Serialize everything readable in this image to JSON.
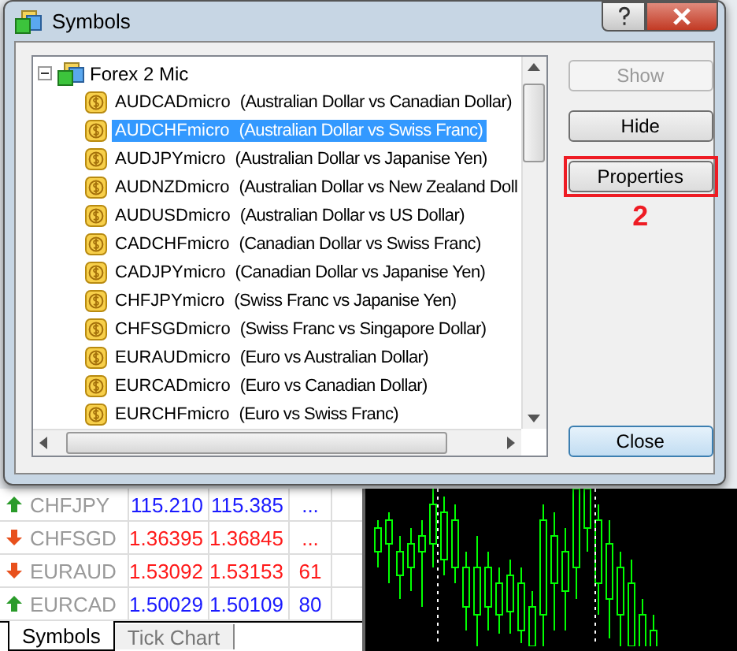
{
  "window": {
    "title": "Symbols"
  },
  "tree": {
    "root": "Forex 2 Mic",
    "expanded": true,
    "items": [
      {
        "code": "AUDCADmicro",
        "description": "(Australian Dollar vs Canadian Dollar)",
        "selected": false
      },
      {
        "code": "AUDCHFmicro",
        "description": "(Australian Dollar vs Swiss Franc)",
        "selected": true
      },
      {
        "code": "AUDJPYmicro",
        "description": "(Australian Dollar vs Japanise Yen)",
        "selected": false
      },
      {
        "code": "AUDNZDmicro",
        "description": "(Australian Dollar vs New Zealand Doll",
        "selected": false
      },
      {
        "code": "AUDUSDmicro",
        "description": "(Australian Dollar vs US Dollar)",
        "selected": false
      },
      {
        "code": "CADCHFmicro",
        "description": "(Canadian Dollar vs Swiss Franc)",
        "selected": false
      },
      {
        "code": "CADJPYmicro",
        "description": "(Canadian Dollar vs Japanise Yen)",
        "selected": false
      },
      {
        "code": "CHFJPYmicro",
        "description": "(Swiss Franc vs Japanise Yen)",
        "selected": false
      },
      {
        "code": "CHFSGDmicro",
        "description": "(Swiss Franc vs Singapore Dollar)",
        "selected": false
      },
      {
        "code": "EURAUDmicro",
        "description": "(Euro vs Australian Dollar)",
        "selected": false
      },
      {
        "code": "EURCADmicro",
        "description": "(Euro vs Canadian Dollar)",
        "selected": false
      },
      {
        "code": "EURCHFmicro",
        "description": "(Euro vs Swiss Franc)",
        "selected": false
      }
    ]
  },
  "buttons": [
    {
      "label": "Show",
      "disabled": true,
      "highlighted": false
    },
    {
      "label": "Hide",
      "disabled": false,
      "highlighted": false
    },
    {
      "label": "Properties",
      "disabled": false,
      "highlighted": true
    }
  ],
  "annotation": "2",
  "close_button": {
    "label": "Close"
  },
  "market_watch": {
    "rows": [
      {
        "symbol": "CHFJPY",
        "kind": "up",
        "bid": "115.210",
        "ask": "115.385",
        "spread": "..."
      },
      {
        "symbol": "CHFSGD",
        "kind": "down",
        "bid": "1.36395",
        "ask": "1.36845",
        "spread": "..."
      },
      {
        "symbol": "EURAUD",
        "kind": "down",
        "bid": "1.53092",
        "ask": "1.53153",
        "spread": "61"
      },
      {
        "symbol": "EURCAD",
        "kind": "up",
        "bid": "1.50029",
        "ask": "1.50109",
        "spread": "80"
      }
    ],
    "tabs": [
      {
        "label": "Symbols",
        "selected": true
      },
      {
        "label": "Tick Chart",
        "selected": false
      }
    ]
  }
}
